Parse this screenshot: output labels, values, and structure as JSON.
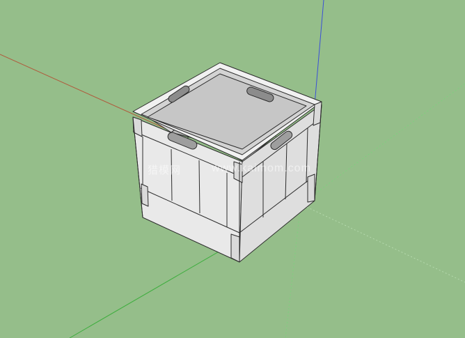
{
  "viewport": {
    "background": "#95be8a",
    "axis_colors": {
      "red": "#b05a3c",
      "green": "#3fae3f",
      "blue": "#3a4fd8"
    }
  },
  "model": {
    "name": "wooden crate",
    "face_color": "#e9e9e9",
    "shadow_color": "#b9b9b9",
    "edge_color": "#2b2b2b"
  },
  "watermark": {
    "chinese_text": "猎模网",
    "url_text": "www.kaimom.com"
  }
}
